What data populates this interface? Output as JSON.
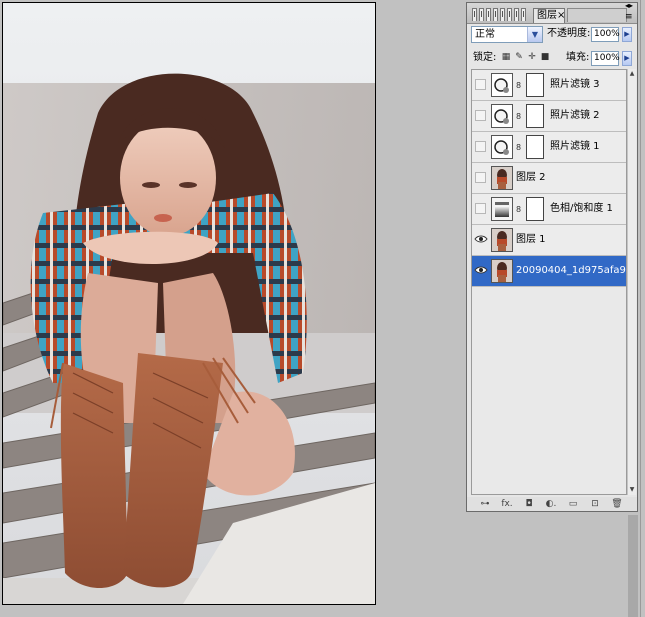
{
  "panel": {
    "title": "图层",
    "close_glyph": "×",
    "collapse_glyph": "◂▸",
    "menu_glyph": "≡",
    "blend_mode": "正常",
    "opacity_label": "不透明度:",
    "opacity_value": "100%",
    "lock_label": "锁定:",
    "fill_label": "填充:",
    "fill_value": "100%",
    "lock_icons": [
      "lock-transparent-icon",
      "lock-image-icon",
      "lock-position-icon",
      "lock-all-icon"
    ]
  },
  "layers": [
    {
      "name": "照片滤镜 3",
      "visible": false,
      "kind": "adjustment-filter"
    },
    {
      "name": "照片滤镜 2",
      "visible": false,
      "kind": "adjustment-filter"
    },
    {
      "name": "照片滤镜 1",
      "visible": false,
      "kind": "adjustment-filter"
    },
    {
      "name": "图层 2",
      "visible": false,
      "kind": "image"
    },
    {
      "name": "色相/饱和度 1",
      "visible": false,
      "kind": "adjustment-hue"
    },
    {
      "name": "图层 1",
      "visible": true,
      "kind": "image"
    },
    {
      "name": "20090404_1d975afa99...",
      "visible": true,
      "kind": "image",
      "selected": true
    }
  ],
  "bottom_tools": [
    {
      "name": "link-layers-icon",
      "glyph": "⊶"
    },
    {
      "name": "fx-icon",
      "glyph": "fx."
    },
    {
      "name": "add-mask-icon",
      "glyph": "◘"
    },
    {
      "name": "new-adjustment-icon",
      "glyph": "◐."
    },
    {
      "name": "new-group-icon",
      "glyph": "▭"
    },
    {
      "name": "new-layer-icon",
      "glyph": "⊡"
    },
    {
      "name": "delete-layer-icon",
      "glyph": "🗑"
    }
  ],
  "colors": {
    "selection": "#3169c6",
    "panel_bg": "#e6e6e6",
    "workspace": "#c1c1c1"
  }
}
